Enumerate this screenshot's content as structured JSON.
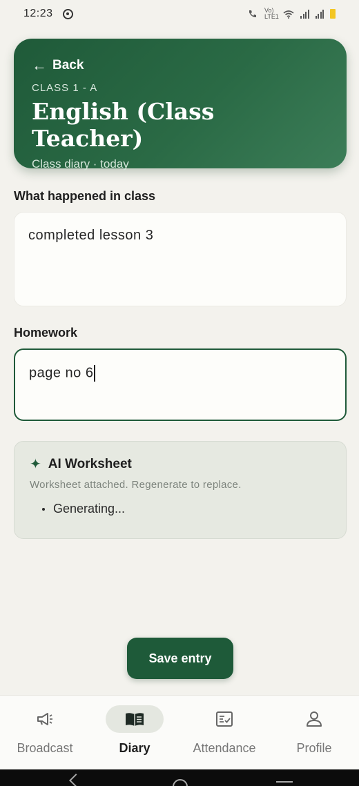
{
  "status_bar": {
    "time": "12:23",
    "network": "Vo) LTE1"
  },
  "header": {
    "back_label": "Back",
    "class_label": "CLASS 1 - A",
    "title": "English (Class Teacher)",
    "subtitle": "Class diary · today"
  },
  "form": {
    "class_notes": {
      "label": "What happened in class",
      "value": "completed lesson 3"
    },
    "homework": {
      "label": "Homework",
      "value": "page no 6"
    }
  },
  "ai_worksheet": {
    "title": "AI Worksheet",
    "note": "Worksheet attached. Regenerate to replace.",
    "status": "Generating..."
  },
  "save_label": "Save entry",
  "nav": {
    "items": [
      {
        "label": "Broadcast",
        "icon": "megaphone-icon",
        "active": false
      },
      {
        "label": "Diary",
        "icon": "book-icon",
        "active": true
      },
      {
        "label": "Attendance",
        "icon": "checklist-icon",
        "active": false
      },
      {
        "label": "Profile",
        "icon": "person-icon",
        "active": false
      }
    ]
  },
  "colors": {
    "primary": "#1f5a39",
    "background": "#f3f2ed",
    "card": "#fdfdfa",
    "ai_card": "#e6e9e1"
  }
}
